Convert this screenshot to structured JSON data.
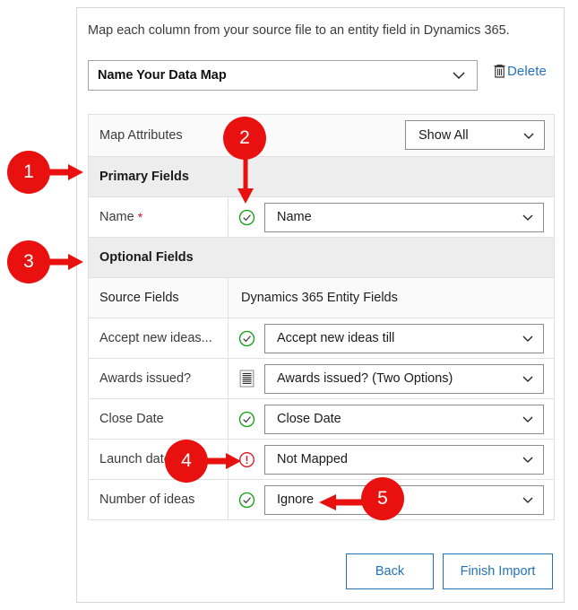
{
  "dialog": {
    "intro_text": "Map each column from your source file to an entity field in Dynamics 365."
  },
  "map_name": {
    "value": "Name Your Data Map",
    "chevron_icon": "chevron-down-icon",
    "delete_label": "Delete",
    "delete_icon": "trash-icon"
  },
  "toolbar": {
    "label": "Map Attributes",
    "filter_value": "Show All",
    "filter_chevron_icon": "chevron-down-icon"
  },
  "sections": {
    "primary": "Primary Fields",
    "optional": "Optional Fields"
  },
  "columns": {
    "source": "Source Fields",
    "target": "Dynamics 365 Entity Fields"
  },
  "primary_rows": [
    {
      "source": "Name",
      "required": true,
      "required_marker": "*",
      "status_icon": "check-circle-icon",
      "status": "mapped",
      "target": "Name"
    }
  ],
  "optional_rows": [
    {
      "source": "Accept new ideas...",
      "status_icon": "check-circle-icon",
      "status": "mapped",
      "target": "Accept new ideas till"
    },
    {
      "source": "Awards issued?",
      "status_icon": "list-icon",
      "status": "option-set",
      "target": "Awards issued? (Two Options)"
    },
    {
      "source": "Close Date",
      "status_icon": "check-circle-icon",
      "status": "mapped",
      "target": "Close Date"
    },
    {
      "source": "Launch date",
      "status_icon": "warning-circle-icon",
      "status": "not-mapped",
      "target": "Not Mapped"
    },
    {
      "source": "Number of ideas",
      "status_icon": "check-circle-icon",
      "status": "mapped",
      "target": "Ignore"
    }
  ],
  "footer": {
    "back_label": "Back",
    "finish_label": "Finish Import"
  },
  "callouts": [
    {
      "number": "1",
      "points_to": "Primary Fields",
      "direction": "right"
    },
    {
      "number": "2",
      "points_to": "Name status icon",
      "direction": "down"
    },
    {
      "number": "3",
      "points_to": "Optional Fields",
      "direction": "right"
    },
    {
      "number": "4",
      "points_to": "Launch date warning icon",
      "direction": "right"
    },
    {
      "number": "5",
      "points_to": "Ignore value",
      "direction": "left"
    }
  ],
  "colors": {
    "accent": "#2372b9",
    "callout": "#e8110f",
    "success": "#10a010",
    "error": "#e01020"
  }
}
